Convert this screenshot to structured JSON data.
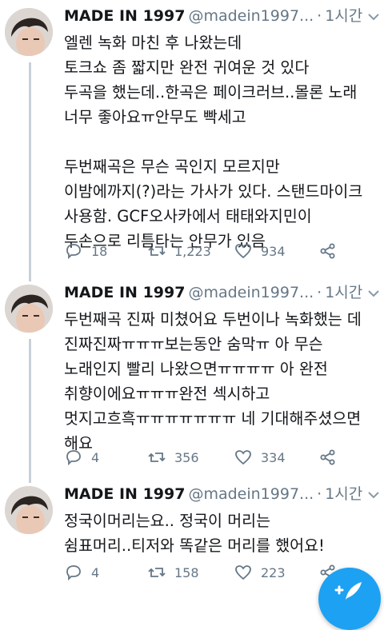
{
  "tweets": [
    {
      "name": "MADE IN 1997",
      "handle": "@madein1997...",
      "separator": "·",
      "time": "1시간",
      "body": "엘렌 녹화 마친 후 나왔는데\n토크쇼 좀 짧지만 완전 귀여운 것 있다\n두곡을 했는데..한곡은 페이크러브..몰론 노래\n너무 좋아요ㅠ안무도 빡세고\n\n두번째곡은 무슨 곡인지 모르지만\n이밤에까지(?)라는 가사가 있다. 스탠드마이크\n사용함. GCF오사카에서 태태와지민이\n두손으로 리틈타는 안무가 있음",
      "replies": "18",
      "retweets": "1,223",
      "likes": "934"
    },
    {
      "name": "MADE IN 1997",
      "handle": "@madein1997...",
      "separator": "·",
      "time": "1시간",
      "body": "두번째곡 진짜 미쳤어요 두번이나 녹화했는 데\n진짜진짜ㅠㅠㅠ보는동안 숨막ㅠ 아 무슨\n노래인지 빨리 나왔으면ㅠㅠㅠㅠ 아 완전\n취향이에요ㅠㅠㅠ완전 섹시하고\n멋지고흐흑ㅠㅠㅠㅠㅠㅠㅠ 네 기대해주셨으면\n해요",
      "replies": "4",
      "retweets": "356",
      "likes": "334"
    },
    {
      "name": "MADE IN 1997",
      "handle": "@madein1997...",
      "separator": "·",
      "time": "1시간",
      "body": "정국이머리는요.. 정국이 머리는\n쉼표머리..티저와 똑같은 머리를 했어요!",
      "replies": "4",
      "retweets": "158",
      "likes": "223"
    }
  ],
  "icons": {
    "reply": "reply-icon",
    "retweet": "retweet-icon",
    "like": "heart-icon",
    "share": "share-icon",
    "menu": "chevron-down-icon",
    "compose": "compose-tweet-icon"
  },
  "colors": {
    "text": "#14171a",
    "secondary": "#657786",
    "thread": "#c8d1d9",
    "accent": "#1da1f2"
  }
}
